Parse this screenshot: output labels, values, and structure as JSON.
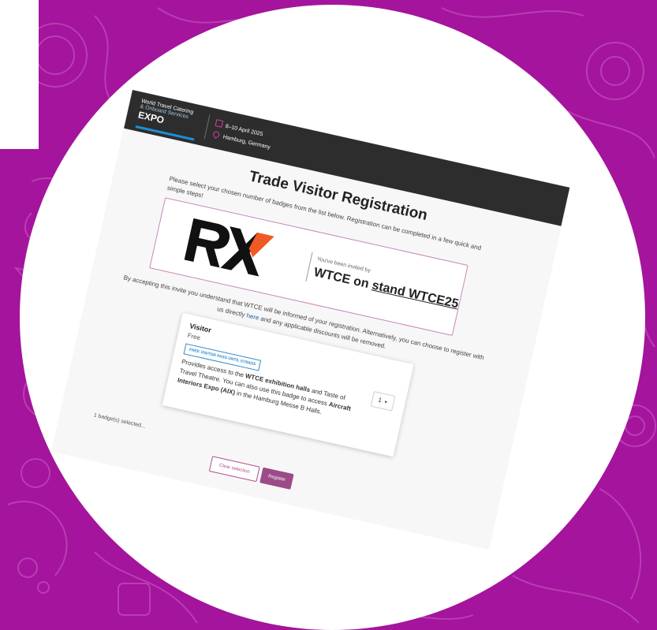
{
  "colors": {
    "background": "#a4149c",
    "accent": "#b04e93",
    "header": "#2d2d2d",
    "link": "#1d5f99"
  },
  "header": {
    "logo_line1": "World Travel Catering",
    "logo_line2": "& Onboard Services",
    "logo_expo": "EXPO",
    "date": "8–10 April 2025",
    "location": "Hamburg, Germany",
    "date_icon": "calendar-icon",
    "location_icon": "location-pin-icon"
  },
  "main": {
    "title": "Trade Visitor Registration",
    "intro": "Please select your chosen number of badges from the list below. Registration can be completed in a few quick and simple steps!",
    "invite": {
      "logo": "RX",
      "invited_by": "You've been invited by",
      "company": "WTCE on",
      "stand": "stand WTCE25"
    },
    "accept_before_link": "By accepting this invite you understand that WTCE will be informed of your registration. Alternatively, you can choose to register with us directly",
    "accept_link": "here",
    "accept_after_link": "and any applicable discounts will be removed.",
    "badge": {
      "name": "Visitor",
      "price": "Free",
      "tag": "FREE VISITOR PASS UNTIL 07/04/25",
      "desc_1": "Provides access to the",
      "desc_bold_1": "WTCE exhibition halls",
      "desc_2": "and Taste of Travel Theatre. You can also use this badge to access",
      "desc_bold_2": "Aircraft Interiors Expo (AIX)",
      "desc_3": "in the Hamburg Messe B Halls.",
      "quantity": "1",
      "quantity_icon": "chevron-down-icon"
    },
    "selected": "1 badge(s) selected...",
    "clear_label": "Clear selection",
    "register_label": "Register"
  }
}
